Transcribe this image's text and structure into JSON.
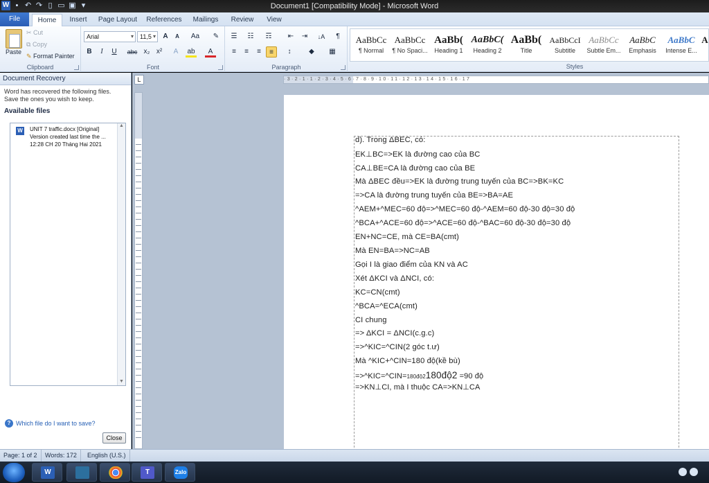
{
  "window": {
    "title": "Document1 [Compatibility Mode] - Microsoft Word"
  },
  "quick_access": {
    "icons": [
      "word-logo-icon",
      "save-icon",
      "undo-icon",
      "redo-icon",
      "new-document-icon",
      "open-icon",
      "print-preview-icon",
      "customize-qat-icon"
    ],
    "word_logo": "W"
  },
  "tabs": [
    {
      "label": "File"
    },
    {
      "label": "Home"
    },
    {
      "label": "Insert"
    },
    {
      "label": "Page Layout"
    },
    {
      "label": "References"
    },
    {
      "label": "Mailings"
    },
    {
      "label": "Review"
    },
    {
      "label": "View"
    }
  ],
  "ribbon": {
    "clipboard": {
      "label": "Clipboard",
      "paste": "Paste",
      "cut": "Cut",
      "copy": "Copy",
      "format_painter": "Format Painter"
    },
    "font": {
      "label": "Font",
      "family": "Arial",
      "size": "11,5",
      "grow": "A",
      "shrink": "A",
      "change_case": "Aa",
      "clear": "✎",
      "bold": "B",
      "italic": "I",
      "underline": "U",
      "strike": "abc",
      "subscript": "x₂",
      "superscript": "x²",
      "text_effects": "A",
      "highlight": "ab",
      "font_color": "A"
    },
    "paragraph": {
      "label": "Paragraph",
      "show_marks": "¶",
      "sort": "↓A"
    },
    "styles": {
      "label": "Styles",
      "items": [
        {
          "preview": "AaBbCc",
          "name": "¶ Normal"
        },
        {
          "preview": "AaBbCc",
          "name": "¶ No Spaci..."
        },
        {
          "preview": "AaBb(",
          "name": "Heading 1"
        },
        {
          "preview": "AaBbC(",
          "name": "Heading 2"
        },
        {
          "preview": "AaBb(",
          "name": "Title"
        },
        {
          "preview": "AaBbCcI",
          "name": "Subtitle"
        },
        {
          "preview": "AaBbCc",
          "name": "Subtle Em..."
        },
        {
          "preview": "AaBbC",
          "name": "Emphasis"
        },
        {
          "preview": "AaBbC",
          "name": "Intense E..."
        },
        {
          "preview": "A",
          "name": ""
        }
      ]
    }
  },
  "recovery_pane": {
    "title": "Document Recovery",
    "message": "Word has recovered the following files.  Save the ones you wish to keep.",
    "available_label": "Available files",
    "file": {
      "name": "UNIT 7 traffic.docx  [Original]",
      "desc": "Version created last time the ...",
      "time": "12:28 CH 20 Tháng Hai 2021"
    },
    "help_link": "Which file do I want to save?",
    "close_label": "Close"
  },
  "document": {
    "lines": [
      "d). Trong ΔBEC, có:",
      "EK⊥BC=>EK là đường cao của BC",
      "CA⊥BE=CA là đường cao của BE",
      "Mà ΔBEC đều=>EK là đường trung tuyến của BC=>BK=KC",
      "=>CA là đường trung tuyến của BE=>BA=AE",
      "^AEM+^MEC=60 độ=>^MEC=60 độ-^AEM=60 độ-30 độ=30 độ",
      "^BCA+^ACE=60 độ=>^ACE=60 độ-^BAC=60 độ-30 độ=30 độ",
      "EN+NC=CE, mà CE=BA(cmt)",
      "Mà EN=BA=>NC=AB",
      "Gọi I là giao điểm của KN và AC",
      "Xét ΔKCI và ΔNCI, có:",
      " KC=CN(cmt)",
      " ^BCA=^ECA(cmt)",
      " CI chung",
      "=> ΔKCI = ΔNCI(c.g.c)",
      "=>^KIC=^CIN(2 góc t.ư)",
      "Mà ^KIC+^CIN=180  độ(kề bù)"
    ],
    "line17": {
      "a": "=>^KIC=^CIN=",
      "b": "180độ2",
      "c": "180độ2",
      "d": " =90 độ"
    },
    "line18": "=>KN⊥CI, mà I thuộc CA=>KN⊥CA"
  },
  "statusbar": {
    "page": "Page: 1 of 2",
    "words": "Words: 172",
    "language": "English (U.S.)"
  },
  "taskbar": {
    "items": [
      {
        "icon": "word-taskbar-icon",
        "text": "W"
      },
      {
        "icon": "photo-app-taskbar-icon",
        "text": ""
      },
      {
        "icon": "chrome-taskbar-icon",
        "text": ""
      },
      {
        "icon": "teams-taskbar-icon",
        "text": "T"
      },
      {
        "icon": "zalo-taskbar-icon",
        "text": "Zalo"
      }
    ]
  }
}
